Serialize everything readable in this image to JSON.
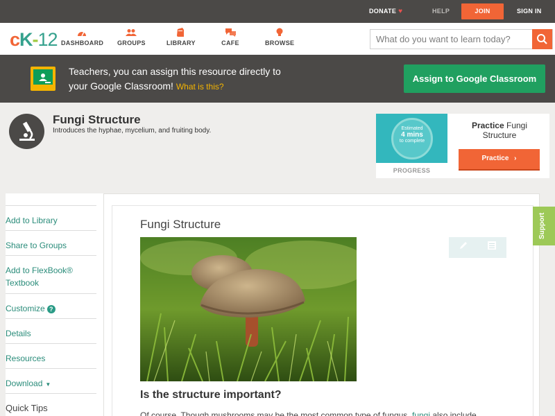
{
  "topbar": {
    "donate": "DONATE",
    "help": "HELP",
    "join": "JOIN",
    "signin": "SIGN IN"
  },
  "nav": {
    "logo": {
      "c": "c",
      "k": "K",
      "dash": "-",
      "n": "12"
    },
    "items": [
      {
        "label": "DASHBOARD",
        "icon": "dashboard-gauge-icon"
      },
      {
        "label": "GROUPS",
        "icon": "groups-people-icon"
      },
      {
        "label": "LIBRARY",
        "icon": "library-book-icon"
      },
      {
        "label": "CAFE",
        "icon": "cafe-chat-icon"
      },
      {
        "label": "BROWSE",
        "icon": "browse-bulb-icon"
      }
    ],
    "search_placeholder": "What do you want to learn today?"
  },
  "banner": {
    "line1": "Teachers, you can assign this resource directly to",
    "line2": "your Google Classroom!",
    "what": "What is this?",
    "assign": "Assign to Google Classroom"
  },
  "concept": {
    "title": "Fungi Structure",
    "description": "Introduces the hyphae, mycelium, and fruiting body."
  },
  "practice": {
    "estimated": "Estimated",
    "mins": "4 mins",
    "to_complete": "to complete",
    "progress": "PROGRESS",
    "title_bold": "Practice",
    "title_rest": "Fungi Structure",
    "button": "Practice"
  },
  "sidebar": {
    "items": [
      {
        "label": "Add to Library"
      },
      {
        "label": "Share to Groups"
      },
      {
        "label": "Add to FlexBook® Textbook"
      },
      {
        "label": "Customize"
      },
      {
        "label": "Details"
      },
      {
        "label": "Resources"
      },
      {
        "label": "Download"
      },
      {
        "label": "Quick Tips"
      }
    ]
  },
  "article": {
    "title": "Fungi Structure",
    "section": "Is the structure important?",
    "para_start": "Of course. Though mushrooms may be the most common type of fungus,",
    "para_link": "fungi",
    "para_end": "also include"
  },
  "support": "Support",
  "colors": {
    "accent_orange": "#f16536",
    "teal": "#35a18d",
    "dark_bar": "#4b4947",
    "green_button": "#20a060",
    "support_green": "#9dc957"
  }
}
